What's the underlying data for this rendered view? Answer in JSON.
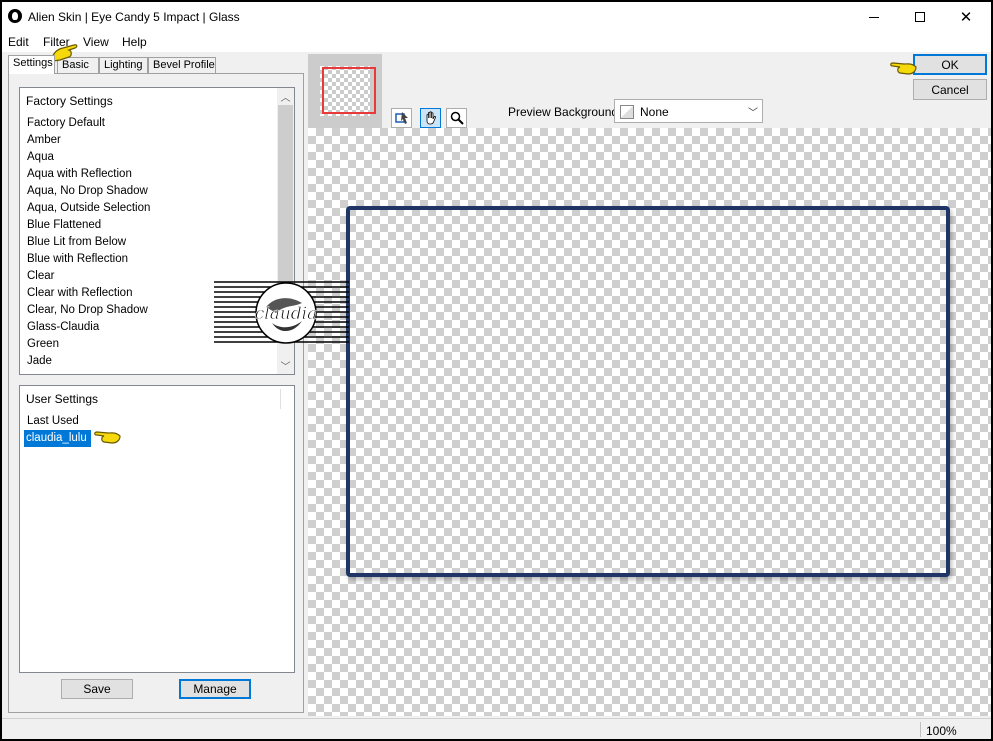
{
  "window": {
    "title": "Alien Skin | Eye Candy 5 Impact | Glass",
    "controls": {
      "minimize": "minimize",
      "maximize": "maximize",
      "close": "close"
    }
  },
  "menu": [
    "Edit",
    "Filter",
    "View",
    "Help"
  ],
  "tabs": [
    "Settings",
    "Basic",
    "Lighting",
    "Bevel Profile"
  ],
  "active_tab": "Settings",
  "factory_settings": {
    "header": "Factory Settings",
    "items": [
      "Factory Default",
      "Amber",
      "Aqua",
      "Aqua with Reflection",
      "Aqua, No Drop Shadow",
      "Aqua, Outside Selection",
      "Blue Flattened",
      "Blue Lit from Below",
      "Blue with Reflection",
      "Clear",
      "Clear with Reflection",
      "Clear, No Drop Shadow",
      "Glass-Claudia",
      "Green",
      "Jade"
    ]
  },
  "user_settings": {
    "header": "User Settings",
    "items": [
      "Last Used",
      "claudia_lulu"
    ],
    "selected": "claudia_lulu"
  },
  "buttons": {
    "save": "Save",
    "manage": "Manage",
    "ok": "OK",
    "cancel": "Cancel"
  },
  "preview": {
    "label": "Preview Background:",
    "value": "None",
    "frame_color": "#1e3566"
  },
  "tools": [
    "navigate-icon",
    "hand-icon",
    "zoom-icon"
  ],
  "status": {
    "zoom": "100%"
  },
  "watermark": {
    "text": "claudia"
  },
  "colors": {
    "highlight": "#0078d7",
    "pointer": "#f5d90a",
    "nav_rect": "#e83a3a"
  }
}
